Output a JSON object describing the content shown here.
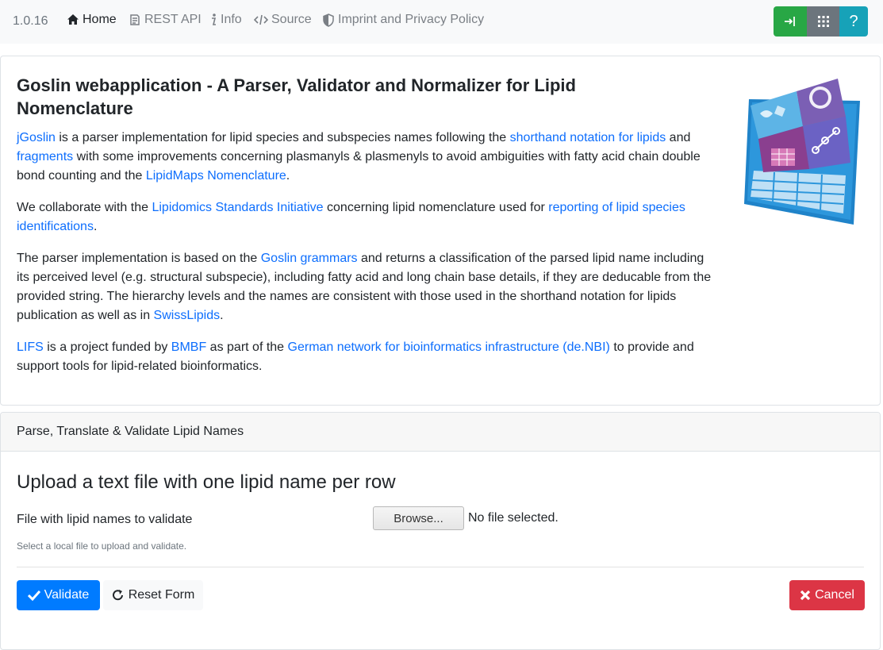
{
  "navbar": {
    "brand": "1.0.16",
    "items": [
      {
        "label": "Home",
        "icon": "home-icon"
      },
      {
        "label": "REST API",
        "icon": "api-icon"
      },
      {
        "label": "Info",
        "icon": "info-icon"
      },
      {
        "label": "Source",
        "icon": "code-icon"
      },
      {
        "label": "Imprint and Privacy Policy",
        "icon": "shield-icon"
      }
    ],
    "buttons": [
      {
        "icon": "login-icon",
        "color": "#28a745"
      },
      {
        "icon": "apps-grid-icon",
        "color": "#6c757d"
      },
      {
        "label": "?",
        "icon": "help-icon",
        "color": "#17a2b8"
      }
    ]
  },
  "intro": {
    "title": "Goslin webapplication - A Parser, Validator and Normalizer for Lipid Nomenclature",
    "p1": {
      "link_jgoslin": "jGoslin",
      "t1": " is a parser implementation for lipid species and subspecies names following the ",
      "link_shorthand": "shorthand notation for lipids",
      "t2": " and ",
      "link_fragments": "fragments",
      "t3": " with some improvements concerning plasmanyls & plasmenyls to avoid ambiguities with fatty acid chain double bond counting and the ",
      "link_lipidmaps": "LipidMaps Nomenclature",
      "t4": "."
    },
    "p2": {
      "t1": "We collaborate with the ",
      "link_lsi": "Lipidomics Standards Initiative",
      "t2": " concerning lipid nomenclature used for ",
      "link_reporting": "reporting of lipid species identifications",
      "t3": "."
    },
    "p3": {
      "t1": "The parser implementation is based on the ",
      "link_grammars": "Goslin grammars",
      "t2": " and returns a classification of the parsed lipid name including its perceived level (e.g. structural subspecie), including fatty acid and long chain base details, if they are deducable from the provided string. The hierarchy levels and the names are consistent with those used in the shorthand notation for lipids publication as well as in ",
      "link_swisslipids": "SwissLipids",
      "t3": "."
    },
    "p4": {
      "link_lifs": "LIFS",
      "t1": " is a project funded by ",
      "link_bmbf": "BMBF",
      "t2": " as part of the ",
      "link_denbi": "German network for bioinformatics infrastructure (de.NBI)",
      "t3": " to provide and support tools for lipid-related bioinformatics."
    }
  },
  "form": {
    "header": "Parse, Translate & Validate Lipid Names",
    "title": "Upload a text file with one lipid name per row",
    "file_label": "File with lipid names to validate",
    "browse_label": "Browse...",
    "file_status": "No file selected.",
    "help_text": "Select a local file to upload and validate.",
    "validate_label": "Validate",
    "reset_label": "Reset Form",
    "cancel_label": "Cancel"
  }
}
